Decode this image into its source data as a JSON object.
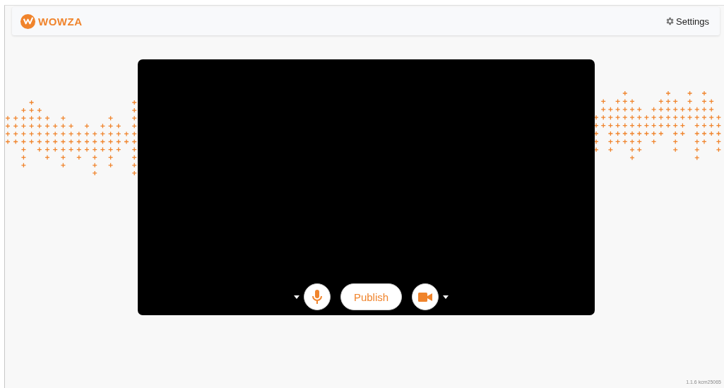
{
  "header": {
    "logo_text": "WOWZA",
    "settings_label": "Settings"
  },
  "video": {
    "controls": [
      {
        "kind": "microphone",
        "caret": true
      },
      {
        "kind": "publish",
        "label": "Publish"
      },
      {
        "kind": "camera",
        "caret": true
      }
    ]
  },
  "version": "1.1.6 kcm25065"
}
